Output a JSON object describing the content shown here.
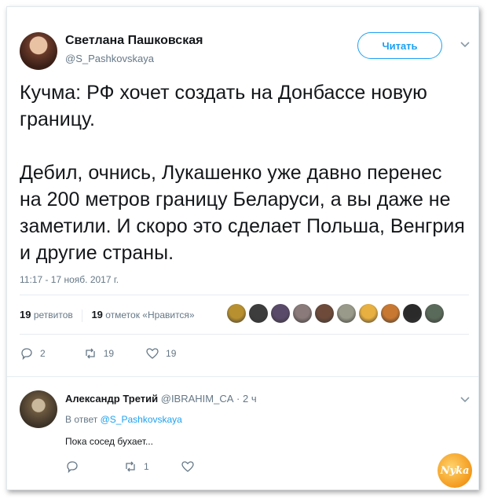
{
  "tweet": {
    "author_name": "Светлана Пашковская",
    "author_handle": "@S_Pashkovskaya",
    "follow_label": "Читать",
    "text": "Кучма: РФ хочет создать на Донбассе новую границу.\n\nДебил, очнись, Лукашенко уже давно перенес на 200 метров границу Беларуси, а вы даже не заметили. И скоро это сделает Польша, Венгрия и другие страны.",
    "timestamp": "11:17 - 17 нояб. 2017 г.",
    "retweets_count": "19",
    "retweets_label": "ретвитов",
    "likes_count": "19",
    "likes_label": "отметок «Нравится»",
    "actions": {
      "reply_count": "2",
      "retweet_count": "19",
      "like_count": "19"
    },
    "liker_colors": [
      "#b8902f",
      "#3d3d3d",
      "#5a4a6a",
      "#8a7a7a",
      "#6d4a3a",
      "#9a9a8a",
      "#e8b040",
      "#c87830",
      "#2a2a2a",
      "#5a6a5a"
    ]
  },
  "reply": {
    "author_name": "Александр Третий",
    "author_handle": "@IBRAHIM_CA",
    "age": "· 2 ч",
    "in_reply_prefix": "В ответ",
    "in_reply_handle": "@S_Pashkovskaya",
    "text": "Пока сосед бухает...",
    "actions": {
      "retweet_count": "1"
    }
  },
  "watermark": "Nyka",
  "colors": {
    "accent": "#1da1f2",
    "muted": "#657786",
    "text": "#14171a"
  }
}
